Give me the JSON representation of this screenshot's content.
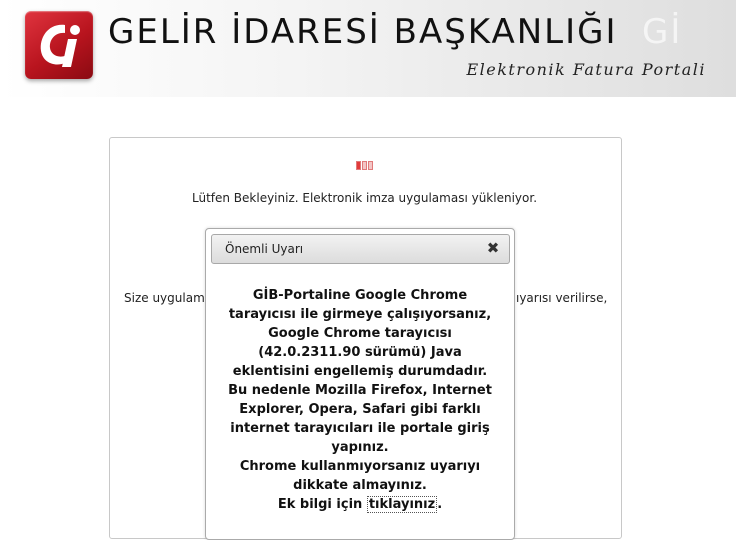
{
  "header": {
    "org_title": "GELİR İDARESİ BAŞKANLIĞI",
    "org_ghost": "Gİ",
    "portal_name": "Elektronik Fatura Portali",
    "logo_icon": "gib-logo-icon",
    "logo_color": "#c41a24"
  },
  "main": {
    "wait_text": "Lütfen Bekleyiniz. Elektronik imza uygulaması yükleniyor.",
    "bg_text_left": "Size uygulama",
    "bg_text_right": "ıyarısı verilirse,"
  },
  "dialog": {
    "title": "Önemli Uyarı",
    "close_icon": "close-icon",
    "lines": [
      "GİB-Portaline Google Chrome",
      "tarayıcısı ile girmeye çalışıyorsanız,",
      "Google Chrome tarayıcısı",
      "(42.0.2311.90 sürümü) Java",
      "eklentisini engellemiş durumdadır.",
      "Bu nedenle Mozilla Firefox, Internet",
      "Explorer, Opera, Safari gibi farklı",
      "internet tarayıcıları ile portale giriş",
      "yapınız.",
      "Chrome kullanmıyorsanız uyarıyı",
      "dikkate almayınız."
    ],
    "more_prefix": "Ek bilgi için ",
    "more_link": "tıklayınız",
    "more_suffix": "."
  }
}
